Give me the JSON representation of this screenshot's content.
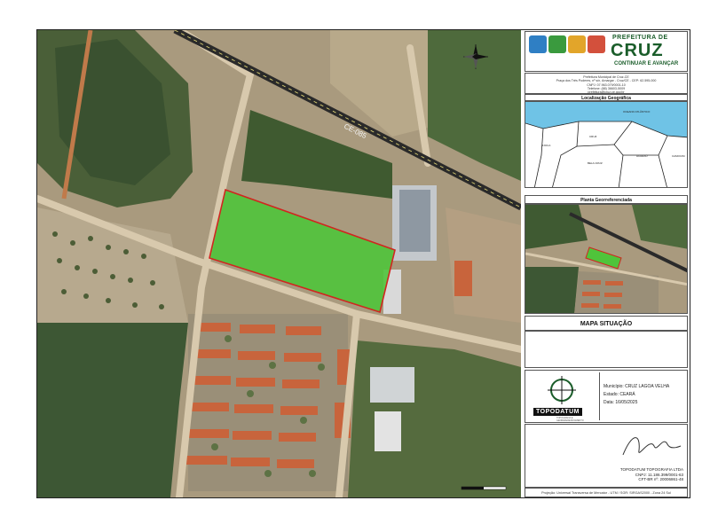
{
  "map": {
    "road_label": "CE-085",
    "north_arrow_icon": "north-arrow-icon",
    "scale_bar_icon": "scale-bar-icon"
  },
  "panel": {
    "logo": {
      "line1": "PREFEITURA DE",
      "line2": "CRUZ",
      "line3": "CONTINUAR E AVANÇAR"
    },
    "address": [
      "Prefeitura Municipal de Cruz-CE",
      "Praça dos Três Poderes, nº s/n, Amargar - Cruz/CE - CEP: 62.595-000",
      "CNPJ: 07.963.079/0001-10",
      "Telefone: (88) 36603-5009",
      "prefeitura@cruz.ce.gov.br"
    ],
    "localizacao_title": "Localização Geográfica",
    "localizacao_labels": [
      "OCEANO ATLÂNTICO",
      "CRUZ",
      "ACARAÚ",
      "BELA CRUZ",
      "JIJOCA",
      "CAMOCIM"
    ],
    "planta_title": "Planta Georreferenciada",
    "situacao_title": "MAPA SITUAÇÃO",
    "info": {
      "municipio": "Município: CRUZ LAGOA VELHA",
      "estado": "Estado: CEARÁ",
      "data": "Data: 16/05/2025"
    },
    "topo_name": "TOPODATUM",
    "topo_sub": "TOPOGRAFIA E GEOREFERENCIAMENTO",
    "signature": {
      "company": "TOPODATUM TOPOGRAFIA LTDA",
      "cnpj": "CNPJ: 11.186.399/0001-63",
      "cft": "CFT-BR nº: 20006861-48"
    },
    "projection": "Projeção: Universal Transversa de Mercator - UTM / SGR: SIRGAS2000 - Zona 24 Sul"
  },
  "colors": {
    "vegetation_dark": "#3f5a32",
    "soil": "#b9a68a",
    "parcel_fill": "#4fc43b",
    "parcel_border": "#d0261f",
    "roof_orange": "#c8643c",
    "sea": "#6fc3e6",
    "brand_green": "#1a5d2a"
  }
}
